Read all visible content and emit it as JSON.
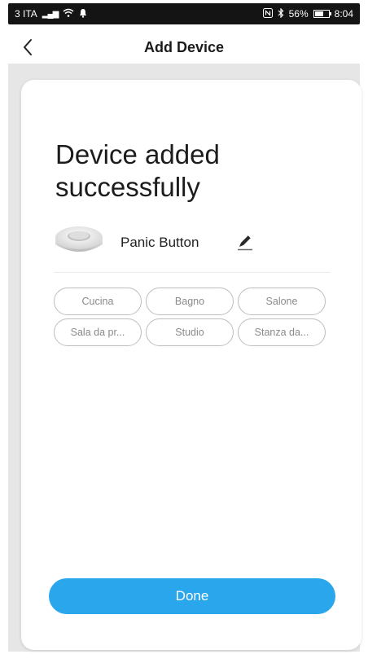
{
  "status_bar": {
    "carrier": "3 ITA",
    "battery_percent": "56%",
    "time": "8:04"
  },
  "header": {
    "title": "Add Device"
  },
  "main": {
    "headline": "Device added successfully",
    "device": {
      "name": "Panic Button",
      "icon": "device-puck-icon"
    },
    "rooms": [
      "Cucina",
      "Bagno",
      "Salone",
      "Sala da pr...",
      "Studio",
      "Stanza da..."
    ],
    "done_label": "Done"
  },
  "colors": {
    "accent": "#2aa6ec",
    "background": "#e6e6e6"
  }
}
